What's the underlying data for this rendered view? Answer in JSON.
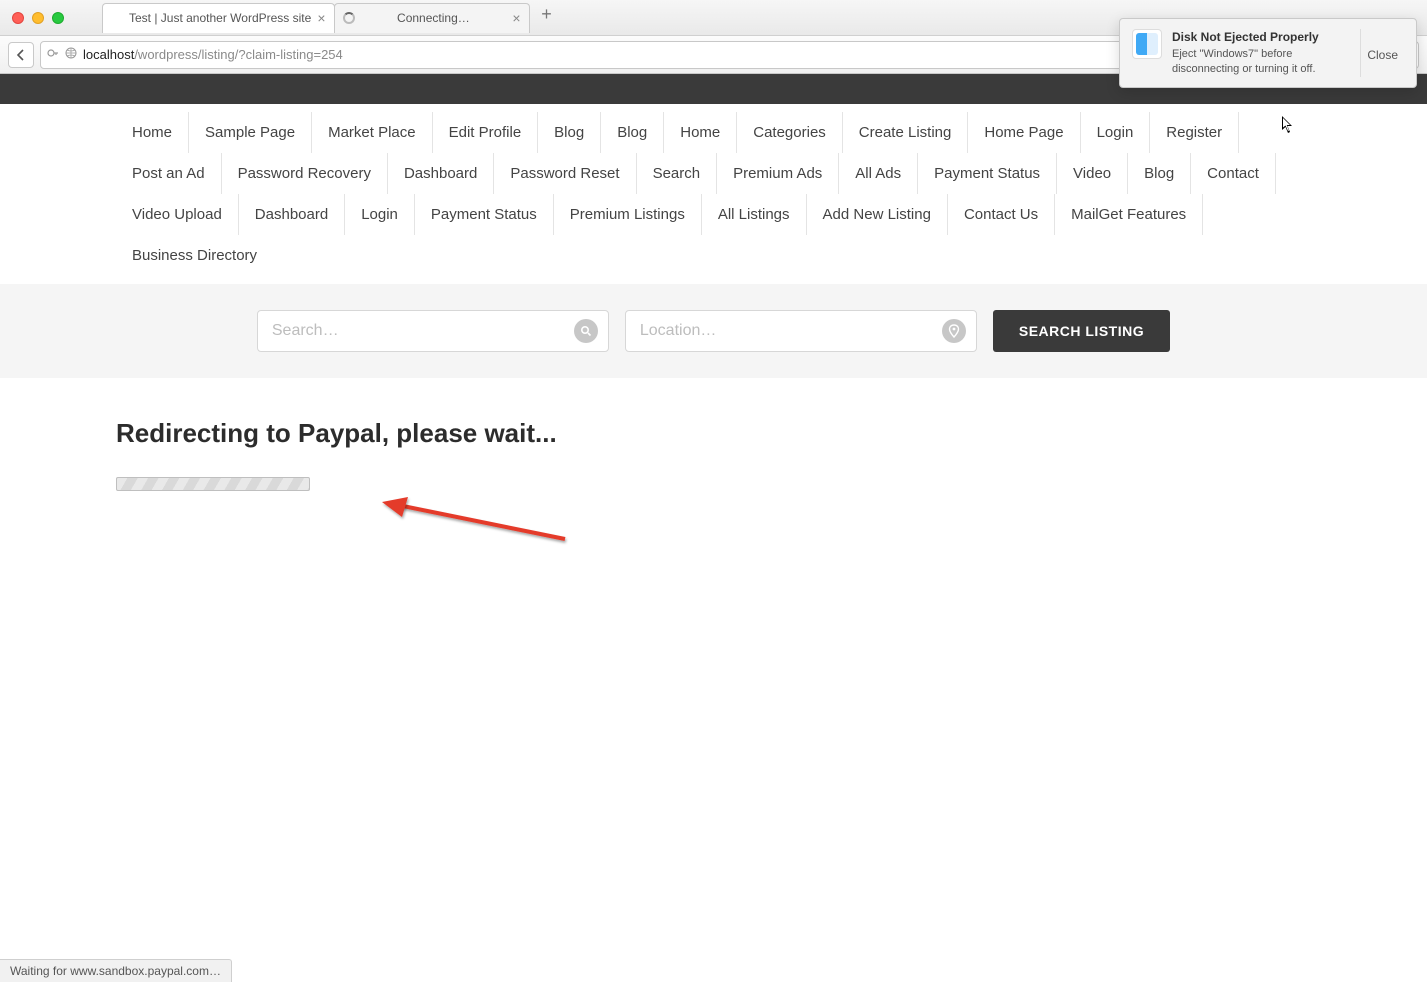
{
  "browser": {
    "tabs": [
      {
        "title": "Test | Just another WordPress site",
        "loading": false
      },
      {
        "title": "Connecting…",
        "loading": true
      }
    ],
    "url_host": "localhost",
    "url_path": "/wordpress/listing/?claim-listing=254",
    "search_placeholder": "Search"
  },
  "notification": {
    "title": "Disk Not Ejected Properly",
    "body": "Eject \"Windows7\" before disconnecting or turning it off.",
    "close": "Close"
  },
  "nav": [
    "Home",
    "Sample Page",
    "Market Place",
    "Edit Profile",
    "Blog",
    "Blog",
    "Home",
    "Categories",
    "Create Listing",
    "Home Page",
    "Login",
    "Register",
    "Post an Ad",
    "Password Recovery",
    "Dashboard",
    "Password Reset",
    "Search",
    "Premium Ads",
    "All Ads",
    "Payment Status",
    "Video",
    "Blog",
    "Contact",
    "Video Upload",
    "Dashboard",
    "Login",
    "Payment Status",
    "Premium Listings",
    "All Listings",
    "Add New Listing",
    "Contact Us",
    "MailGet Features",
    "Business Directory"
  ],
  "search_strip": {
    "search_placeholder": "Search…",
    "location_placeholder": "Location…",
    "button": "SEARCH LISTING"
  },
  "page": {
    "heading": "Redirecting to Paypal, please wait..."
  },
  "status_bar": "Waiting for www.sandbox.paypal.com…"
}
